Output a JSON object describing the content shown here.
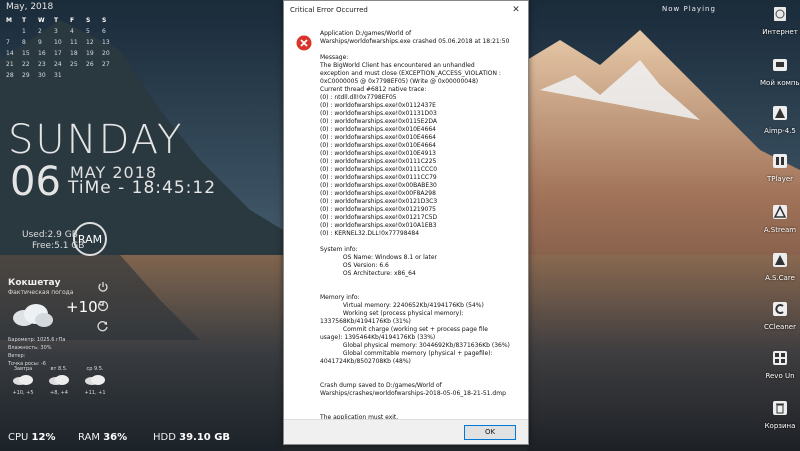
{
  "calendar": {
    "title": "May, 2018",
    "weekdays": [
      "M",
      "T",
      "W",
      "T",
      "F",
      "S",
      "S"
    ],
    "days": [
      "",
      "1",
      "2",
      "3",
      "4",
      "5",
      "6",
      "7",
      "8",
      "9",
      "10",
      "11",
      "12",
      "13",
      "14",
      "15",
      "16",
      "17",
      "18",
      "19",
      "20",
      "21",
      "22",
      "23",
      "24",
      "25",
      "26",
      "27",
      "28",
      "29",
      "30",
      "31",
      "",
      ""
    ]
  },
  "clock": {
    "dayname": "SUNDAY",
    "daynum": "06",
    "monthyear": "MAY 2018",
    "time": "TiMe - 18:45:12"
  },
  "ram": {
    "used": "Used:2.9 GB",
    "free": "Free:5.1 GB",
    "label": "RAM"
  },
  "weather": {
    "city": "Кокшетау",
    "desc": "Фактическая погода",
    "temp": "+10°",
    "details": [
      "Барометр: 1025.6 гПа",
      "Влажность: 30%",
      "Ветер:",
      "Точка росы: -6"
    ],
    "forecast": [
      {
        "day": "Завтра",
        "temps": "+10, +5"
      },
      {
        "day": "вт 8.5.",
        "temps": "+8, +4"
      },
      {
        "day": "ср 9.5.",
        "temps": "+11, +1"
      }
    ]
  },
  "now_playing": "Now Playing",
  "desktop_icons": [
    {
      "label": "Интернет",
      "icon": "globe-icon"
    },
    {
      "label": "Мой компьютер",
      "icon": "computer-icon"
    },
    {
      "label": "Aimp-4.5",
      "icon": "aimp-icon"
    },
    {
      "label": "TPlayer",
      "icon": "tplayer-icon"
    },
    {
      "label": "A.Stream",
      "icon": "astream-icon"
    },
    {
      "label": "A.S.Care",
      "icon": "ascare-icon"
    },
    {
      "label": "CCleaner",
      "icon": "ccleaner-icon"
    },
    {
      "label": "Revo Un",
      "icon": "revo-icon"
    },
    {
      "label": "Корзина",
      "icon": "recycle-bin-icon"
    }
  ],
  "stats": {
    "cpu_label": "CPU",
    "cpu_value": "12%",
    "ram_label": "RAM",
    "ram_value": "36%",
    "hdd_label": "HDD",
    "hdd_value": "39.10 GB"
  },
  "dialog": {
    "title": "Critical Error Occurred",
    "close": "✕",
    "ok_label": "OK",
    "lines": [
      "Application D:/games/World of",
      "Warships/worldofwarships.exe crashed 05.06.2018 at 18:21:50",
      "",
      "Message:",
      "The BigWorld Client has encountered an unhandled",
      "exception and must close (EXCEPTION_ACCESS_VIOLATION :",
      "0xC0000005 @ 0x7798EF05) (Write @ 0x00000048)",
      "Current thread #6812 native trace:",
      "(0) : ntdll.dll!0x7798EF05",
      "(0) : worldofwarships.exe!0x0112437E",
      "(0) : worldofwarships.exe!0x01131D03",
      "(0) : worldofwarships.exe!0x0115E2DA",
      "(0) : worldofwarships.exe!0x010E4664",
      "(0) : worldofwarships.exe!0x010E4664",
      "(0) : worldofwarships.exe!0x010E4664",
      "(0) : worldofwarships.exe!0x010E4913",
      "(0) : worldofwarships.exe!0x0111C225",
      "(0) : worldofwarships.exe!0x0111CCC0",
      "(0) : worldofwarships.exe!0x0111CC79",
      "(0) : worldofwarships.exe!0x00BABE30",
      "(0) : worldofwarships.exe!0x00F8A298",
      "(0) : worldofwarships.exe!0x0121D3C3",
      "(0) : worldofwarships.exe!0x01219075",
      "(0) : worldofwarships.exe!0x01217C5D",
      "(0) : worldofwarships.exe!0x010A1EB3",
      "(0) : KERNEL32.DLL!0x77798484",
      "",
      "System info:",
      "            OS Name: Windows 8.1 or later",
      "            OS Version: 6.6",
      "            OS Architecture: x86_64",
      "",
      "",
      "Memory info:",
      "            Virtual memory: 2240652Kb/4194176Kb (54%)",
      "            Working set (process physical memory):",
      "1337568Kb/4194176Kb (31%)",
      "            Commit charge (working set + process page file",
      "usage): 1395464Kb/4194176Kb (33%)",
      "            Global physical memory: 3044692Kb/8371636Kb (36%)",
      "            Global commitable memory (physical + pagefile):",
      "4041724Kb/8502708Kb (48%)",
      "",
      "",
      "Crash dump saved to D:/games/World of",
      "Warships/crashes/worldofwarships-2018-05-06_18-21-51.dmp",
      "",
      "",
      "The application must exit."
    ]
  }
}
